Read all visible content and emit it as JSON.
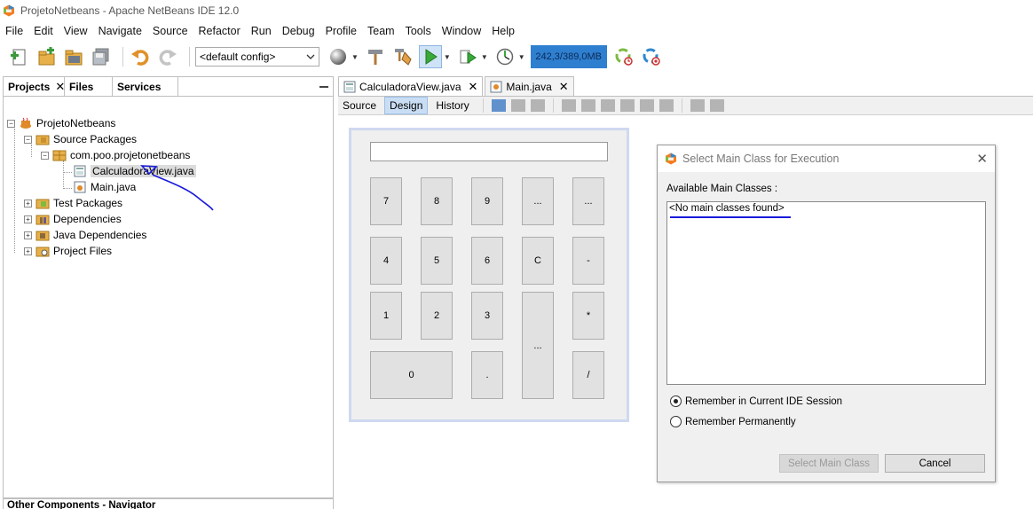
{
  "window": {
    "title": "ProjetoNetbeans - Apache NetBeans IDE 12.0"
  },
  "menu": [
    "File",
    "Edit",
    "View",
    "Navigate",
    "Source",
    "Refactor",
    "Run",
    "Debug",
    "Profile",
    "Team",
    "Tools",
    "Window",
    "Help"
  ],
  "toolbar": {
    "config": "<default config>",
    "memory": "242,3/389,0MB"
  },
  "left_panel": {
    "tabs": [
      "Projects",
      "Files",
      "Services"
    ],
    "tree": {
      "project": "ProjetoNetbeans",
      "source_packages": "Source Packages",
      "package": "com.poo.projetonetbeans",
      "file1": "CalculadoraView.java",
      "file2": "Main.java",
      "test_packages": "Test Packages",
      "dependencies": "Dependencies",
      "java_dependencies": "Java Dependencies",
      "project_files": "Project Files"
    },
    "bottom_title": "Other Components - Navigator"
  },
  "editor": {
    "tabs": [
      "CalculadoraView.java",
      "Main.java"
    ],
    "views": [
      "Source",
      "Design",
      "History"
    ],
    "active_view": "Design"
  },
  "calculator": {
    "buttons": [
      "7",
      "8",
      "9",
      "...",
      "...",
      "4",
      "5",
      "6",
      "C",
      "-",
      "1",
      "2",
      "3",
      "...",
      "*",
      "0",
      ".",
      "/"
    ]
  },
  "dialog": {
    "title": "Select Main Class for Execution",
    "label": "Available Main Classes :",
    "list_item": "<No main classes found>",
    "radio1": "Remember in Current IDE Session",
    "radio2": "Remember Permanently",
    "select_button": "Select Main Class",
    "cancel_button": "Cancel"
  },
  "colors": {
    "memory_bar": "#2f7fd0",
    "annotation": "#1a1adc",
    "design_selection": "#c9def5"
  }
}
